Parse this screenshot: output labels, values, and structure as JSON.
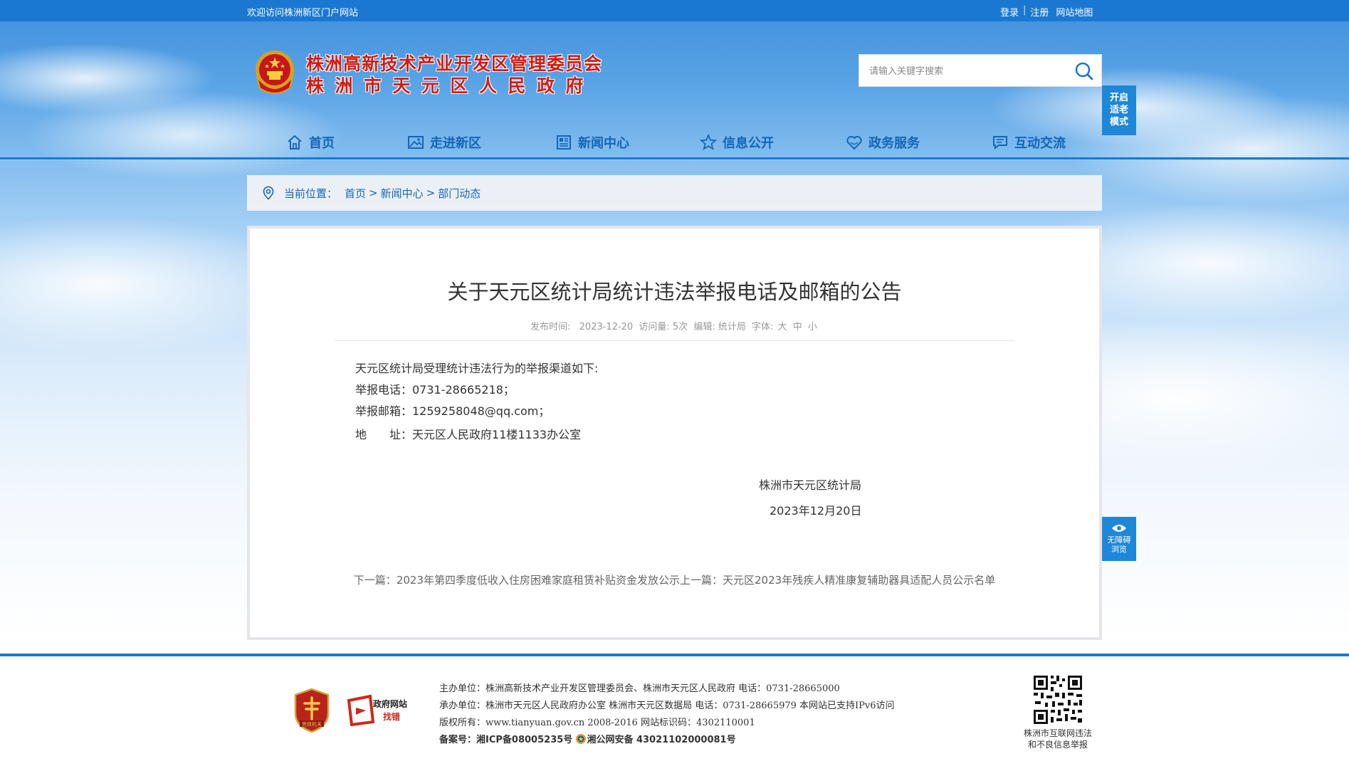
{
  "topbar": {
    "welcome": "欢迎访问株洲新区门户网站",
    "login": "登录",
    "register": "注册",
    "sitemap": "网站地图",
    "separator": "|"
  },
  "logo": {
    "line1": "株洲高新技术产业开发区管理委员会",
    "line2": "株洲市天元区人民政府",
    "emblem_icon": "national-emblem-icon"
  },
  "search": {
    "placeholder": "请输入关键字搜索",
    "icon": "search-icon"
  },
  "elder_mode": {
    "line1": "开启",
    "line2": "适老",
    "line3": "模式"
  },
  "nav": {
    "items": [
      {
        "label": "首页",
        "icon": "home-icon"
      },
      {
        "label": "走进新区",
        "icon": "picture-icon"
      },
      {
        "label": "新闻中心",
        "icon": "newspaper-icon"
      },
      {
        "label": "信息公开",
        "icon": "star-icon"
      },
      {
        "label": "政务服务",
        "icon": "heart-icon"
      },
      {
        "label": "互动交流",
        "icon": "chat-icon"
      }
    ]
  },
  "breadcrumb": {
    "label": "当前位置：",
    "items": [
      "首页",
      "新闻中心",
      "部门动态"
    ],
    "separator": ">"
  },
  "article": {
    "title": "关于天元区统计局统计违法举报电话及邮箱的公告",
    "meta": {
      "publish_label": "发布时间:",
      "publish_date": "2023-12-20",
      "views_label": "访问量:",
      "views": "5次",
      "editor_label": "编辑:",
      "editor": "统计局",
      "font_label": "字体:",
      "font_large": "大",
      "font_medium": "中",
      "font_small": "小"
    },
    "body": {
      "intro": "天元区统计局受理统计违法行为的举报渠道如下:",
      "phone": "举报电话：0731-28665218；",
      "email": "举报邮箱：1259258048@qq.com；",
      "address_label": "地　　址：",
      "address": "天元区人民政府11楼1133办公室"
    },
    "signature": {
      "org": "株洲市天元区统计局",
      "date": "2023年12月20日"
    },
    "pager": {
      "next_label": "下一篇：",
      "next_title": "2023年第四季度低收入住房困难家庭租赁补贴资金发放公示",
      "prev_label": "上一篇：",
      "prev_title": "天元区2023年残疾人精准康复辅助器具适配人员公示名单"
    }
  },
  "accessibility": {
    "line1": "无障碍",
    "line2": "浏览"
  },
  "footer": {
    "host": "主办单位：株洲高新技术产业开发区管理委员会、株洲市天元区人民政府 电话：0731-28665000",
    "organizer": "承办单位：株洲市天元区人民政府办公室 株洲市天元区数据局 电话：0731-28665979 本网站已支持IPv6访问",
    "copyright": "版权所有：www.tianyuan.gov.cn 2008-2016 网站标识码：4302110001",
    "icp_label": "备案号：",
    "icp": "湘ICP备08005235号",
    "police": "湘公网安备 43021102000081号",
    "badge1": "党政机关",
    "badge2_line1": "政府网站",
    "badge2_line2": "找错",
    "qr_caption_line1": "株洲市互联网违法",
    "qr_caption_line2": "和不良信息举报"
  },
  "colors": {
    "primary_blue": "#1a78d2",
    "nav_text": "#1565b5",
    "logo_red": "#d01c13"
  }
}
